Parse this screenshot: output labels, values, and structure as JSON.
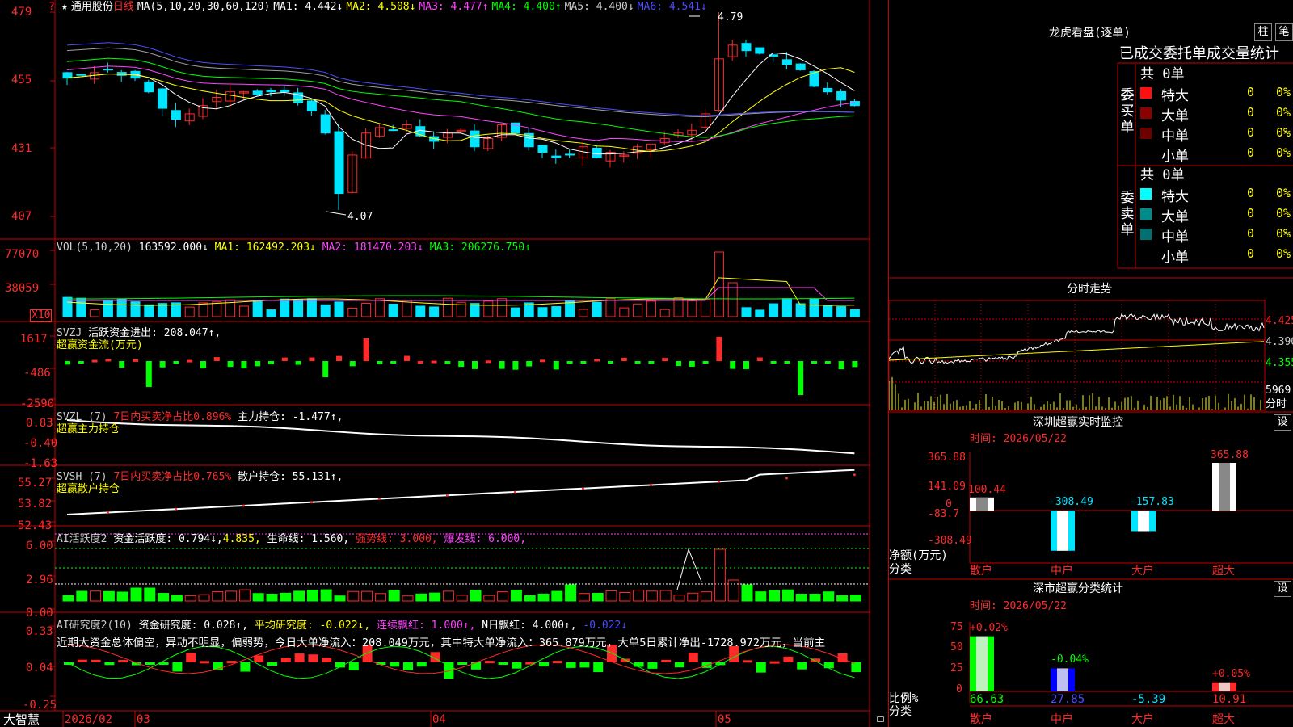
{
  "colors": {
    "up": "#ff2a2a",
    "down": "#00e5ff",
    "grid": "#c80000",
    "green": "#00ff00",
    "yellow": "#ffff00",
    "magenta": "#ff44ff",
    "white": "#ffffff",
    "grayline": "#a0a0a0",
    "blueline": "#4d4dff",
    "darkgreen": "#00c000"
  },
  "header": {
    "mark": "?",
    "star": "★",
    "stock": "通用股份",
    "period": "日线",
    "ma_title": "MA(5,10,20,30,60,120)",
    "ma1": "MA1: 4.442↓",
    "ma2": "MA2: 4.508↓",
    "ma3": "MA3: 4.477↑",
    "ma4": "MA4: 4.400↑",
    "ma5": "MA5: 4.400↓",
    "ma6": "MA6: 4.541↓"
  },
  "price_axis": [
    "479",
    "455",
    "431",
    "407"
  ],
  "price_marks": {
    "high": "4.79",
    "low": "4.07"
  },
  "vol": {
    "title": "VOL(5,10,20)",
    "value": "163592.000↓",
    "ma1": "MA1: 162492.203↓",
    "ma2": "MA2: 181470.203↓",
    "ma3": "MA3: 206276.750↑",
    "axis": [
      "77070",
      "38059"
    ],
    "unit": "X10"
  },
  "svzj": {
    "title": "SVZJ",
    "label": "活跃资金进出: 208.047↑,",
    "sub": "超赢资金流(万元)",
    "axis": [
      "1617",
      "-486",
      "-2590"
    ]
  },
  "svzl": {
    "title": "SVZL (7)",
    "label": "7日内买卖净占比0.896%",
    "label2": "主力持仓: -1.477↑,",
    "sub": "超赢主力持仓",
    "axis": [
      "0.83",
      "-0.40",
      "-1.63"
    ]
  },
  "svsh": {
    "title": "SVSH (7)",
    "label": "7日内买卖净占比0.765%",
    "label2": "散户持仓: 55.131↑,",
    "sub": "超赢散户持仓",
    "axis": [
      "55.27",
      "53.82",
      "52.43"
    ]
  },
  "ai1": {
    "title": "AI活跃度2",
    "a": "资金活跃度: 0.794↓,",
    "b": "4.835,",
    "c": "生命线: 1.560,",
    "d": "强势线: 3.000,",
    "e": "爆发线: 6.000,",
    "axis": [
      "6.00",
      "2.96",
      "0.00"
    ]
  },
  "ai2": {
    "title": "AI研究度2(10)",
    "a": "资金研究度: 0.028↑,",
    "b": "平均研究度: -0.022↓,",
    "c": "连续飘红: 1.000↑,",
    "d": "N日飘红: 4.000↑,",
    "e": "-0.022↓",
    "text": "近期大资金总体偏空，异动不明显，偏弱势，今日大单净流入：208.049万元，其中特大单净流入：365.879万元，大单5日累计净出-1728.972万元，当前主",
    "axis": [
      "0.33",
      "0.04",
      "-0.25"
    ]
  },
  "datebar": {
    "brand": "大智慧",
    "d1": "2026/02",
    "d2": "03",
    "d3": "04",
    "d4": "05"
  },
  "side": {
    "title": "龙虎看盘(逐单)",
    "btn1": "柱",
    "btn2": "笔",
    "stats_title": "已成交委托单成交量统计",
    "buy": {
      "group": "委买单",
      "total": "共 0单",
      "rows": [
        {
          "name": "特大",
          "v": "0",
          "p": "0%"
        },
        {
          "name": "大单",
          "v": "0",
          "p": "0%"
        },
        {
          "name": "中单",
          "v": "0",
          "p": "0%"
        },
        {
          "name": "小单",
          "v": "0",
          "p": "0%"
        }
      ]
    },
    "sell": {
      "group": "委卖单",
      "total": "共 0单",
      "rows": [
        {
          "name": "特大",
          "v": "0",
          "p": "0%"
        },
        {
          "name": "大单",
          "v": "0",
          "p": "0%"
        },
        {
          "name": "中单",
          "v": "0",
          "p": "0%"
        },
        {
          "name": "小单",
          "v": "0",
          "p": "0%"
        }
      ]
    },
    "fenshi": {
      "title": "分时走势",
      "axis": [
        "4.425",
        "4.390",
        "4.355"
      ],
      "vol": "5969",
      "unit": "分时"
    },
    "mon": {
      "title": "深圳超赢实时监控",
      "btn": "设",
      "time": "时间: 2026/05/22",
      "axis": [
        "365.88",
        "141.09",
        "0",
        "-83.7",
        "-308.49"
      ],
      "net": "净额(万元)",
      "cat": "分类",
      "bars": [
        {
          "name": "散户",
          "val": 100.44,
          "label": "100.44"
        },
        {
          "name": "中户",
          "val": -308.49,
          "label": "-308.49"
        },
        {
          "name": "大户",
          "val": -157.83,
          "label": "-157.83"
        },
        {
          "name": "超大",
          "val": 365.88,
          "label": "365.88"
        }
      ]
    },
    "cls": {
      "title": "深市超赢分类统计",
      "btn": "设",
      "time": "时间: 2026/05/22",
      "axis": [
        "75",
        "50",
        "25",
        "0"
      ],
      "ratio": "比例%",
      "cat": "分类",
      "bars": [
        {
          "name": "散户",
          "val": 66.63,
          "top": "+0.02%",
          "bottom": "66.63"
        },
        {
          "name": "中户",
          "val": 27.85,
          "top": "-0.04%",
          "bottom": "27.85"
        },
        {
          "name": "大户",
          "val": -5.39,
          "top": "",
          "bottom": "-5.39"
        },
        {
          "name": "超大",
          "val": 10.91,
          "top": "+0.05%",
          "bottom": "10.91"
        }
      ]
    }
  }
}
